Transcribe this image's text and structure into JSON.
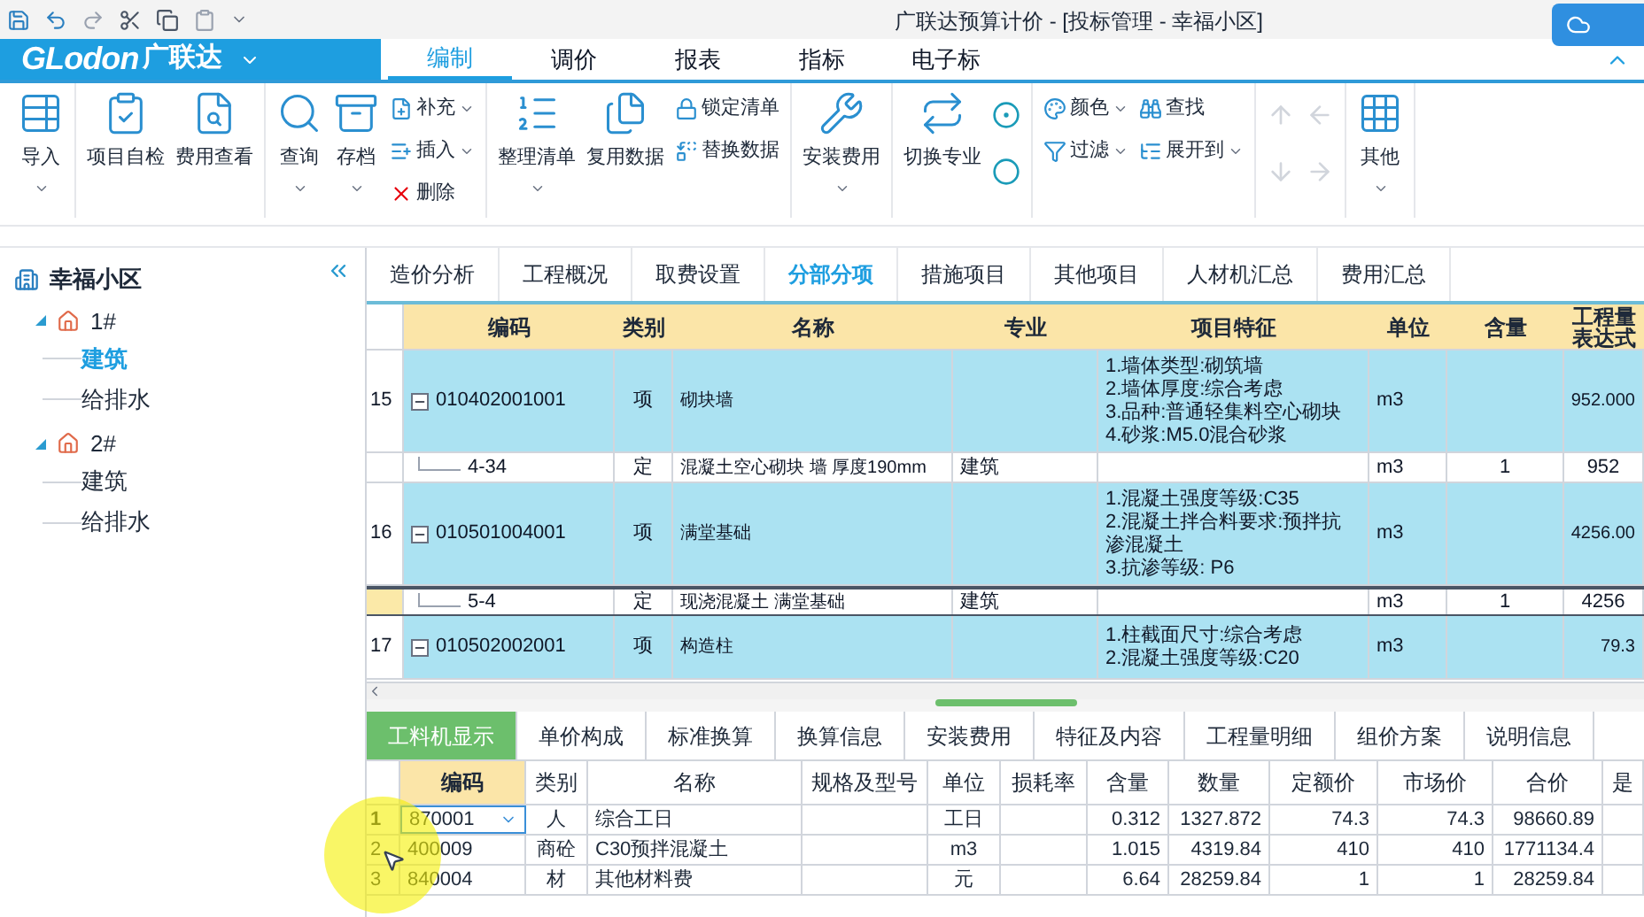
{
  "title_bar": {
    "title": "广联达预算计价 - [投标管理 - 幸福小区]"
  },
  "menu": {
    "logo_latin": "GLodon",
    "logo_cn": "广联达",
    "tabs": [
      {
        "label": "编制",
        "selected": true
      },
      {
        "label": "调价",
        "selected": false
      },
      {
        "label": "报表",
        "selected": false
      },
      {
        "label": "指标",
        "selected": false
      },
      {
        "label": "电子标",
        "selected": false
      }
    ]
  },
  "ribbon": {
    "groups": [
      {
        "columns": [
          {
            "kind": "large",
            "label": "导入",
            "dropdown": true
          }
        ]
      },
      {
        "columns": [
          {
            "kind": "large",
            "label": "项目自检",
            "dropdown": false
          },
          {
            "kind": "large",
            "label": "费用查看",
            "dropdown": false
          }
        ]
      },
      {
        "columns": [
          {
            "kind": "large",
            "label": "查询",
            "dropdown": true
          },
          {
            "kind": "large",
            "label": "存档",
            "dropdown": true
          },
          {
            "kind": "stack",
            "items": [
              {
                "label": "补充",
                "dropdown": true
              },
              {
                "label": "插入",
                "dropdown": true
              },
              {
                "label": "删除",
                "dropdown": false
              }
            ]
          }
        ]
      },
      {
        "columns": [
          {
            "kind": "large",
            "label": "整理清单",
            "dropdown": true
          },
          {
            "kind": "large",
            "label": "复用数据",
            "dropdown": false
          },
          {
            "kind": "stack",
            "items": [
              {
                "label": "锁定清单",
                "dropdown": false
              },
              {
                "label": "替换数据",
                "dropdown": false
              }
            ]
          }
        ]
      },
      {
        "columns": [
          {
            "kind": "large",
            "label": "安装费用",
            "dropdown": true
          }
        ]
      },
      {
        "columns": [
          {
            "kind": "large",
            "label": "切换专业",
            "dropdown": false
          },
          {
            "kind": "icons",
            "items": [
              {
                "disabled": false
              },
              {
                "disabled": false
              }
            ]
          }
        ]
      },
      {
        "columns": [
          {
            "kind": "stack",
            "items": [
              {
                "label": "颜色",
                "dropdown": true
              },
              {
                "label": "过滤",
                "dropdown": true
              }
            ]
          },
          {
            "kind": "stack",
            "items": [
              {
                "label": "查找",
                "dropdown": false
              },
              {
                "label": "展开到",
                "dropdown": true
              }
            ]
          }
        ]
      },
      {
        "columns": [
          {
            "kind": "icons",
            "items": [
              {
                "disabled": true
              },
              {
                "disabled": true
              }
            ]
          },
          {
            "kind": "icons",
            "items": [
              {
                "disabled": true
              },
              {
                "disabled": true
              }
            ]
          }
        ]
      },
      {
        "columns": [
          {
            "kind": "large",
            "label": "其他",
            "dropdown": true
          }
        ]
      }
    ]
  },
  "project_tree": {
    "root": "幸福小区",
    "children": [
      {
        "label": "1#",
        "expanded": true,
        "selected": false,
        "children": [
          {
            "label": "建筑",
            "selected": true
          },
          {
            "label": "给排水",
            "selected": false
          }
        ]
      },
      {
        "label": "2#",
        "expanded": true,
        "selected": false,
        "children": [
          {
            "label": "建筑",
            "selected": false
          },
          {
            "label": "给排水",
            "selected": false
          }
        ]
      }
    ]
  },
  "view_tabs": [
    {
      "label": "造价分析",
      "selected": false
    },
    {
      "label": "工程概况",
      "selected": false
    },
    {
      "label": "取费设置",
      "selected": false
    },
    {
      "label": "分部分项",
      "selected": true
    },
    {
      "label": "措施项目",
      "selected": false
    },
    {
      "label": "其他项目",
      "selected": false
    },
    {
      "label": "人材机汇总",
      "selected": false
    },
    {
      "label": "费用汇总",
      "selected": false
    }
  ],
  "bill_table": {
    "columns": [
      "编码",
      "类别",
      "名称",
      "专业",
      "项目特征",
      "单位",
      "含量",
      "工程量表达式"
    ],
    "rows": [
      {
        "kind": "item",
        "number": "15",
        "code": "010402001001",
        "category": "项",
        "name": "砌块墙",
        "features": [
          "1.墙体类型:砌筑墙",
          "2.墙体厚度:综合考虑",
          "3.品种:普通轻集料空心砌块",
          "4.砂浆:M5.0混合砂浆"
        ],
        "unit": "m3",
        "quantity": "952.000",
        "expanded": true,
        "selected": false
      },
      {
        "kind": "quota",
        "code": "4-34",
        "category": "定",
        "name": "混凝土空心砌块 墙 厚度190mm",
        "specialty": "建筑",
        "unit": "m3",
        "content": "1",
        "quantity": "952",
        "selected": false
      },
      {
        "kind": "item",
        "number": "16",
        "code": "010501004001",
        "category": "项",
        "name": "满堂基础",
        "features": [
          "1.混凝土强度等级:C35",
          "2.混凝土拌合料要求:预拌抗渗混凝土",
          "3.抗渗等级: P6"
        ],
        "unit": "m3",
        "quantity": "4256.00",
        "expanded": true,
        "selected": false
      },
      {
        "kind": "quota",
        "code": "5-4",
        "category": "定",
        "name": "现浇混凝土 满堂基础",
        "specialty": "建筑",
        "unit": "m3",
        "content": "1",
        "quantity": "4256",
        "selected": true
      },
      {
        "kind": "item",
        "number": "17",
        "code": "010502002001",
        "category": "项",
        "name": "构造柱",
        "features": [
          "1.柱截面尺寸:综合考虑",
          "2.混凝土强度等级:C20"
        ],
        "unit": "m3",
        "quantity": "79.3",
        "expanded": true,
        "selected": false
      }
    ]
  },
  "detail_tabs": [
    {
      "label": "工料机显示",
      "selected": true
    },
    {
      "label": "单价构成",
      "selected": false
    },
    {
      "label": "标准换算",
      "selected": false
    },
    {
      "label": "换算信息",
      "selected": false
    },
    {
      "label": "安装费用",
      "selected": false
    },
    {
      "label": "特征及内容",
      "selected": false
    },
    {
      "label": "工程量明细",
      "selected": false
    },
    {
      "label": "组价方案",
      "selected": false
    },
    {
      "label": "说明信息",
      "selected": false
    }
  ],
  "resource_table": {
    "columns": [
      "编码",
      "类别",
      "名称",
      "规格及型号",
      "单位",
      "损耗率",
      "含量",
      "数量",
      "定额价",
      "市场价",
      "合价",
      "是"
    ],
    "rows": [
      {
        "number": "1",
        "code": "870001",
        "category": "人",
        "name": "综合工日",
        "unit": "工日",
        "content": "0.312",
        "quantity": "1327.872",
        "quota_price": "74.3",
        "market_price": "74.3",
        "total": "98660.89",
        "selected": true
      },
      {
        "number": "2",
        "code": "400009",
        "category": "商砼",
        "name": "C30预拌混凝土",
        "unit": "m3",
        "content": "1.015",
        "quantity": "4319.84",
        "quota_price": "410",
        "market_price": "410",
        "total": "1771134.4",
        "selected": false
      },
      {
        "number": "3",
        "code": "840004",
        "category": "材",
        "name": "其他材料费",
        "unit": "元",
        "content": "6.64",
        "quantity": "28259.84",
        "quota_price": "1",
        "market_price": "1",
        "total": "28259.84",
        "selected": false
      }
    ]
  }
}
